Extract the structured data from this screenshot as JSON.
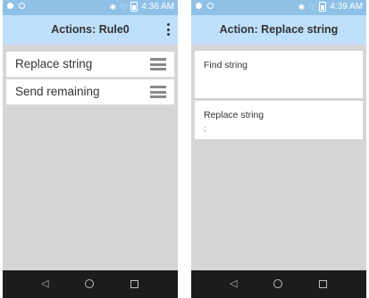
{
  "left_screen": {
    "status": {
      "time": "4:36 AM"
    },
    "appbar": {
      "title": "Actions: Rule0"
    },
    "items": [
      {
        "label": "Replace string"
      },
      {
        "label": "Send remaining"
      }
    ]
  },
  "right_screen": {
    "status": {
      "time": "4:39 AM"
    },
    "appbar": {
      "title": "Action: Replace string"
    },
    "fields": [
      {
        "label": "Find string",
        "value": ""
      },
      {
        "label": "Replace string",
        "value": ";"
      }
    ]
  },
  "icons": {
    "status_left": [
      "notification-dot-icon",
      "sync-icon"
    ],
    "status_right": [
      "bluetooth-icon",
      "wifi-icon",
      "battery-icon"
    ],
    "nav": [
      "back-icon",
      "home-icon",
      "recents-icon"
    ],
    "menu": "overflow-menu-icon",
    "drag": "drag-handle-icon"
  },
  "colors": {
    "status_bar": "#8fc1e6",
    "app_bar": "#bfe0fb",
    "background": "#d6d6d6",
    "nav_bar": "#1c1c1c"
  }
}
